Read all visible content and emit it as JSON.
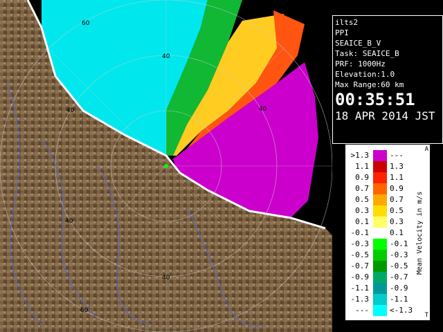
{
  "info": {
    "radar": "ilts2",
    "mode": "PPI",
    "product": "SEAICE_B_V",
    "task": "Task: SEAICE_B",
    "prf": "PRF: 1000Hz",
    "elevation": "Elevation:1.0",
    "max_range": "Max Range:60 km",
    "time": "00:35:51",
    "date": "18 APR 2014 JST"
  },
  "legend": {
    "title": "Mean Velocity in m/s",
    "corner_top": "A",
    "corner_bottom": "T",
    "rows": [
      {
        "lo": ">1.3",
        "hi": "---",
        "color": "#cc00cc"
      },
      {
        "lo": "1.1",
        "hi": "1.3",
        "color": "#cc0000"
      },
      {
        "lo": "0.9",
        "hi": "1.1",
        "color": "#ff2200"
      },
      {
        "lo": "0.7",
        "hi": "0.9",
        "color": "#ff6600"
      },
      {
        "lo": "0.5",
        "hi": "0.7",
        "color": "#ffaa00"
      },
      {
        "lo": "0.3",
        "hi": "0.5",
        "color": "#ffdd00"
      },
      {
        "lo": "0.1",
        "hi": "0.3",
        "color": "#ffff66"
      },
      {
        "lo": "-0.1",
        "hi": "0.1",
        "color": "#ffffff"
      },
      {
        "lo": "-0.3",
        "hi": "-0.1",
        "color": "#00ff00"
      },
      {
        "lo": "-0.5",
        "hi": "-0.3",
        "color": "#00cc00"
      },
      {
        "lo": "-0.7",
        "hi": "-0.5",
        "color": "#009900"
      },
      {
        "lo": "-0.9",
        "hi": "-0.7",
        "color": "#00aa66"
      },
      {
        "lo": "-1.1",
        "hi": "-0.9",
        "color": "#009999"
      },
      {
        "lo": "-1.3",
        "hi": "-1.1",
        "color": "#00cccc"
      },
      {
        "lo": "---",
        "hi": "<-1.3",
        "color": "#00ffff"
      }
    ]
  },
  "map": {
    "range_labels": [
      "60",
      "40",
      "40",
      "40",
      "40",
      "40",
      "60"
    ],
    "terrain_color": "#7a6040",
    "sea_color": "#000000",
    "ice_color": "#ffffff"
  }
}
